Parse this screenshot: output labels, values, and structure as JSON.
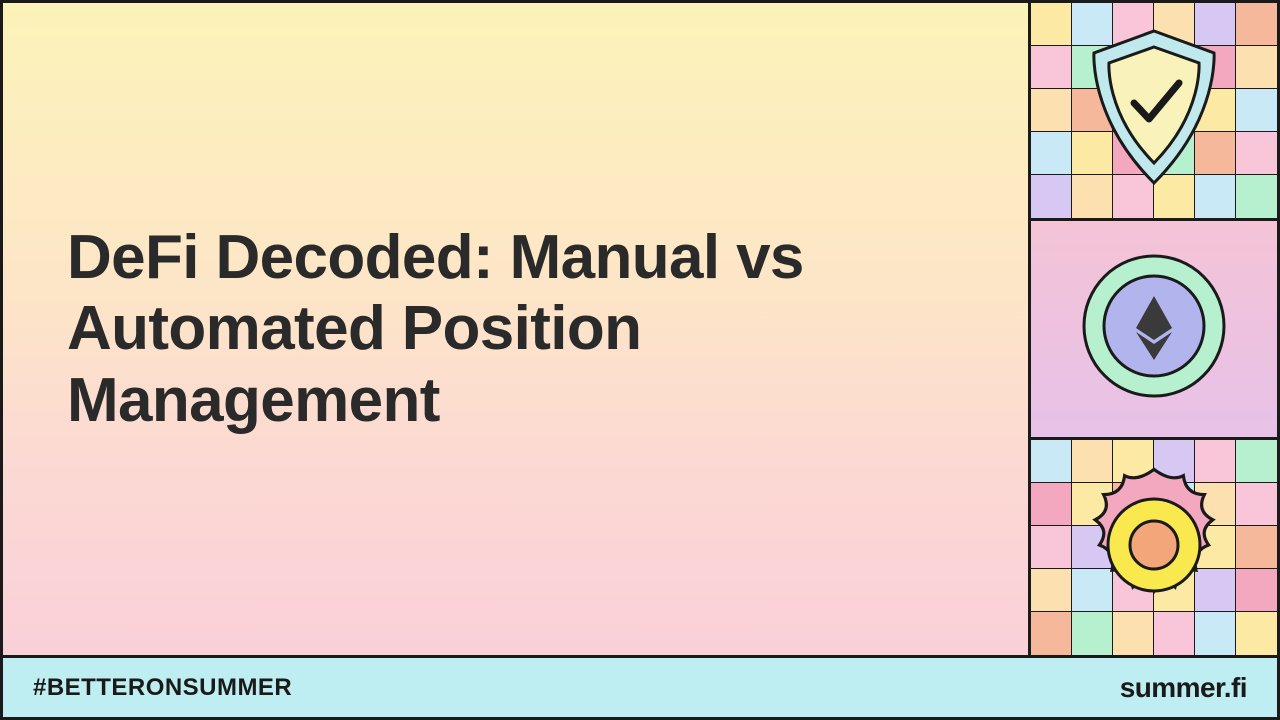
{
  "main": {
    "title": "DeFi Decoded: Manual vs Automated Position Management"
  },
  "footer": {
    "hashtag": "#BETTERONSUMMER",
    "brand": "summer.fi"
  },
  "sidebar": {
    "badges": [
      "shield-check",
      "ethereum-token",
      "sun-ring"
    ]
  }
}
